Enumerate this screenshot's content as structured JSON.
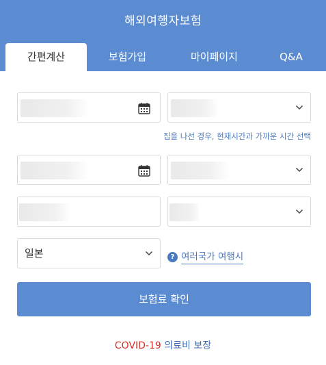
{
  "header": {
    "title": "해외여행자보험",
    "background_color": "#5b8bd0"
  },
  "tabs": [
    {
      "label": "간편계산",
      "active": true
    },
    {
      "label": "보험가입",
      "active": false
    },
    {
      "label": "마이페이지",
      "active": false
    },
    {
      "label": "Q&A",
      "active": false
    }
  ],
  "form": {
    "departure_date": {
      "icon": "calendar-icon"
    },
    "departure_time": {
      "icon": "chevron-down-icon"
    },
    "time_hint": "집을 나선 경우, 현재시간과 가까운 시간 선택",
    "return_date": {
      "icon": "calendar-icon"
    },
    "return_time": {
      "icon": "chevron-down-icon"
    },
    "birthdate": {},
    "gender": {
      "icon": "chevron-down-icon"
    },
    "country": {
      "value": "일본",
      "icon": "chevron-down-icon"
    },
    "multi_country_link": "여러국가 여행시",
    "multi_country_icon": "question-circle-icon"
  },
  "cta": {
    "label": "보험료 확인"
  },
  "footer": {
    "covid_red": "COVID-19",
    "covid_blue": "의료비 보장",
    "red_color": "#d9302c",
    "blue_color": "#3f6eb5"
  }
}
